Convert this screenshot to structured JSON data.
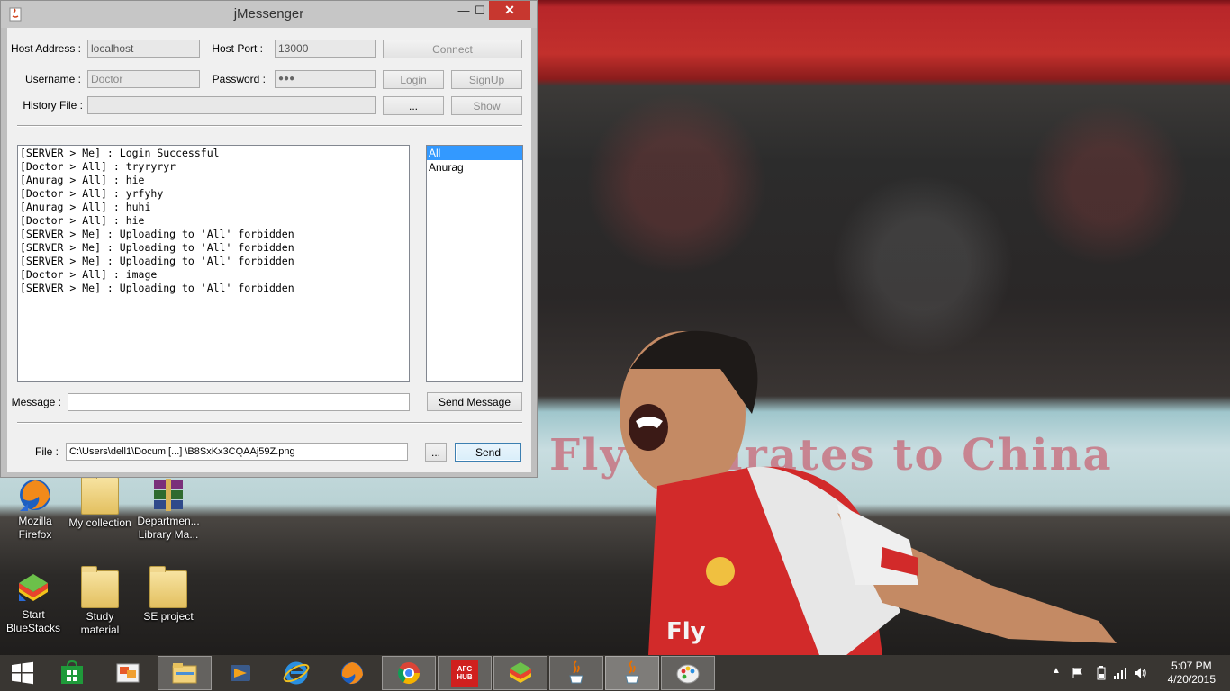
{
  "window": {
    "title": "jMessenger",
    "controls": {
      "minimize": "—",
      "maximize": "☐",
      "close": "✕"
    }
  },
  "connection": {
    "host_label": "Host Address :",
    "host_value": "localhost",
    "port_label": "Host Port :",
    "port_value": "13000",
    "connect_label": "Connect",
    "username_label": "Username :",
    "username_value": "Doctor",
    "password_label": "Password :",
    "password_value": "●●●",
    "login_label": "Login",
    "signup_label": "SignUp",
    "history_label": "History File :",
    "history_value": "",
    "browse_label": "...",
    "show_label": "Show"
  },
  "chat": {
    "lines": [
      "[SERVER > Me] : Login Successful",
      "[Doctor > All] : tryryryr",
      "[Anurag > All] : hie",
      "[Doctor > All] : yrfyhy",
      "[Anurag > All] : huhi",
      "[Doctor > All] : hie",
      "[SERVER > Me] : Uploading to 'All' forbidden",
      "[SERVER > Me] : Uploading to 'All' forbidden",
      "[SERVER > Me] : Uploading to 'All' forbidden",
      "[Doctor > All] : image",
      "[SERVER > Me] : Uploading to 'All' forbidden"
    ]
  },
  "users": {
    "items": [
      "All",
      "Anurag"
    ],
    "selected": "All"
  },
  "message": {
    "label": "Message :",
    "value": "",
    "send_label": "Send Message"
  },
  "file": {
    "label": "File :",
    "value": "C:\\Users\\dell1\\Docum [...] \\B8SxKx3CQAAj59Z.png",
    "browse_label": "...",
    "send_label": "Send"
  },
  "desktop": {
    "icons": [
      {
        "label": "Mozilla Firefox",
        "icon": "firefox-icon"
      },
      {
        "label": "My collection",
        "icon": "folder-icon"
      },
      {
        "label": "Departmen... Library Ma...",
        "icon": "winrar-icon"
      },
      {
        "label": "Start BlueStacks",
        "icon": "bluestacks-icon"
      },
      {
        "label": "Study material",
        "icon": "folder-icon"
      },
      {
        "label": "SE project",
        "icon": "folder-icon"
      }
    ],
    "wallpaper_banner": "Fly Emirates to China"
  },
  "taskbar": {
    "items": [
      {
        "name": "store",
        "icon": "store-icon"
      },
      {
        "name": "paint",
        "icon": "paint-icon"
      },
      {
        "name": "file-explorer",
        "icon": "folder-icon"
      },
      {
        "name": "media",
        "icon": "media-icon"
      },
      {
        "name": "internet-explorer",
        "icon": "ie-icon"
      },
      {
        "name": "firefox",
        "icon": "firefox-icon"
      },
      {
        "name": "chrome",
        "icon": "chrome-icon"
      },
      {
        "name": "afc-hub",
        "icon": "afc-hub-icon",
        "text": "AFC HUB"
      },
      {
        "name": "bluestacks",
        "icon": "bluestacks-icon"
      },
      {
        "name": "java-1",
        "icon": "java-icon"
      },
      {
        "name": "java-2",
        "icon": "java-icon"
      },
      {
        "name": "paint-palette",
        "icon": "palette-icon"
      }
    ],
    "clock": {
      "time": "5:07 PM",
      "date": "4/20/2015"
    }
  },
  "colors": {
    "selection": "#3399ff",
    "close_button": "#c7372f",
    "window_bg": "#f0f0f0"
  }
}
